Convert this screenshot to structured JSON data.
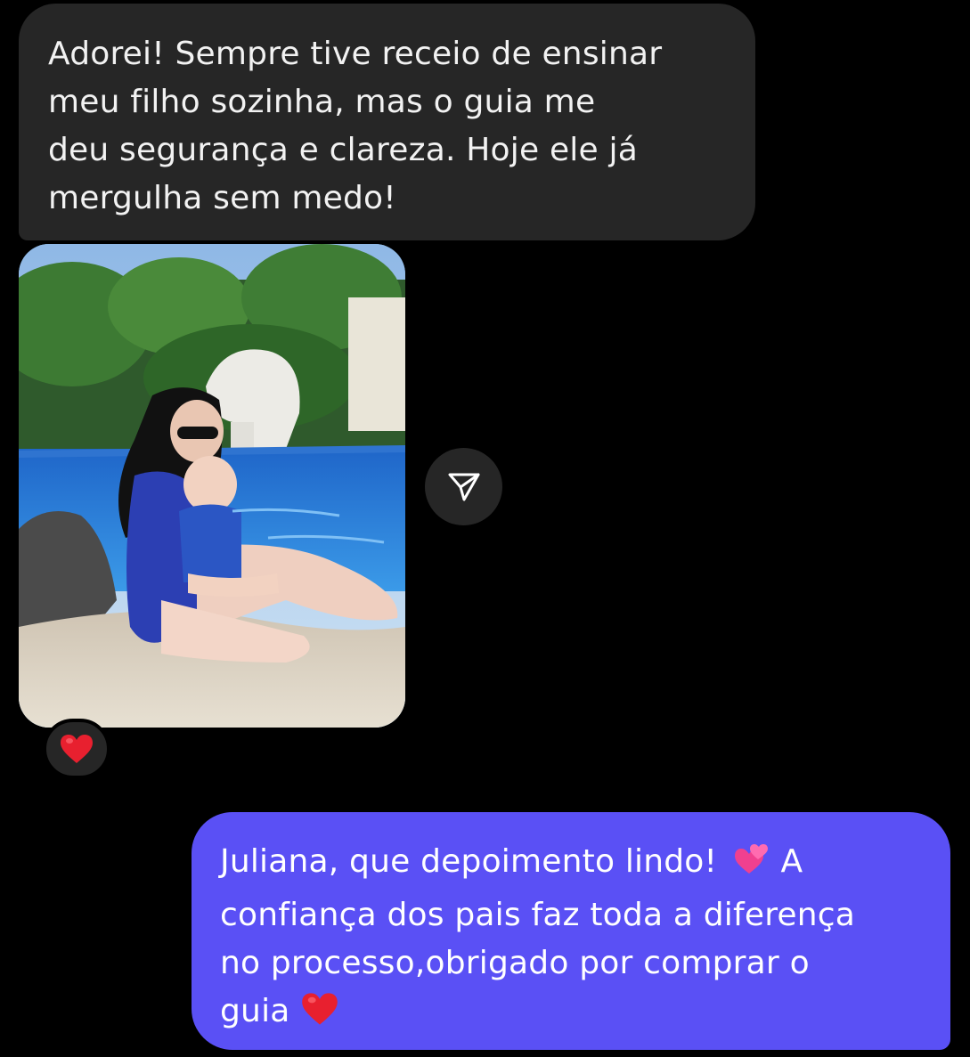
{
  "messages": {
    "incoming_text": "Adorei! Sempre tive receio de ensinar\nmeu filho sozinha, mas o guia me\ndeu segurança e clareza. Hoje ele já\nmergulha sem medo!",
    "photo_reaction": "heart-emoji",
    "outgoing_line1": "Juliana, que depoimento lindo! ",
    "outgoing_line1_emoji": "two-hearts-emoji",
    "outgoing_line1_end": " A",
    "outgoing_rest": "confiança dos pais faz toda a diferença\nno processo,obrigado por comprar o\nguia ",
    "outgoing_end_emoji": "heart-emoji"
  },
  "icons": {
    "share": "paper-plane-icon",
    "reaction": "red-heart-icon"
  },
  "colors": {
    "background": "#000000",
    "incoming_bubble": "#262626",
    "outgoing_bubble": "#5a50f5",
    "text": "#ffffff"
  }
}
